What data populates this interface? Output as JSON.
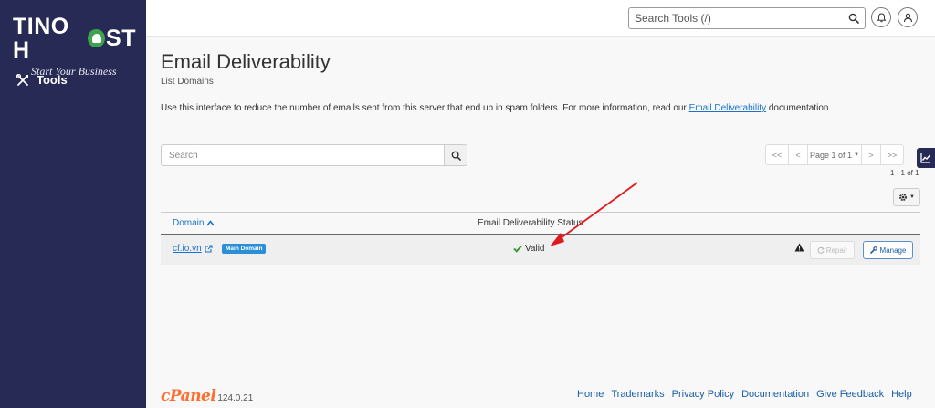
{
  "brand": {
    "logo_prefix": "TINO H",
    "logo_suffix": "ST",
    "tagline": "Start Your Business"
  },
  "sidebar": {
    "items": [
      {
        "label": "Tools",
        "icon": "tools-icon"
      }
    ]
  },
  "topbar": {
    "search_placeholder": "Search Tools (/)",
    "icons": [
      "search-icon",
      "bell-icon",
      "user-icon"
    ]
  },
  "page": {
    "title": "Email Deliverability",
    "subtitle": "List Domains",
    "intro_before": "Use this interface to reduce the number of emails sent from this server that end up in spam folders. For more information, read our ",
    "intro_link": "Email Deliverability",
    "intro_after": " documentation."
  },
  "list": {
    "search_placeholder": "Search",
    "pager": {
      "first": "<<",
      "prev": "<",
      "page_label": "Page 1 of 1",
      "next": ">",
      "last": ">>"
    },
    "count": "1 - 1 of 1"
  },
  "table": {
    "columns": {
      "domain": "Domain",
      "status": "Email Deliverability Status"
    },
    "rows": [
      {
        "domain": "cf.io.vn",
        "badge": "Main Domain",
        "status": "Valid",
        "repair_label": "Repair",
        "manage_label": "Manage"
      }
    ]
  },
  "footer": {
    "brand": "cPanel",
    "version": "124.0.21",
    "links": [
      "Home",
      "Trademarks",
      "Privacy Policy",
      "Documentation",
      "Give Feedback",
      "Help"
    ]
  },
  "colors": {
    "sidebar_bg": "#262a54",
    "link": "#1a73c8",
    "badge_bg": "#2a8fd6",
    "valid_check": "#3c9a3c",
    "annotation_arrow": "#e0191f",
    "cpanel_orange": "#ff6c2c",
    "logo_green": "#3da44d"
  }
}
